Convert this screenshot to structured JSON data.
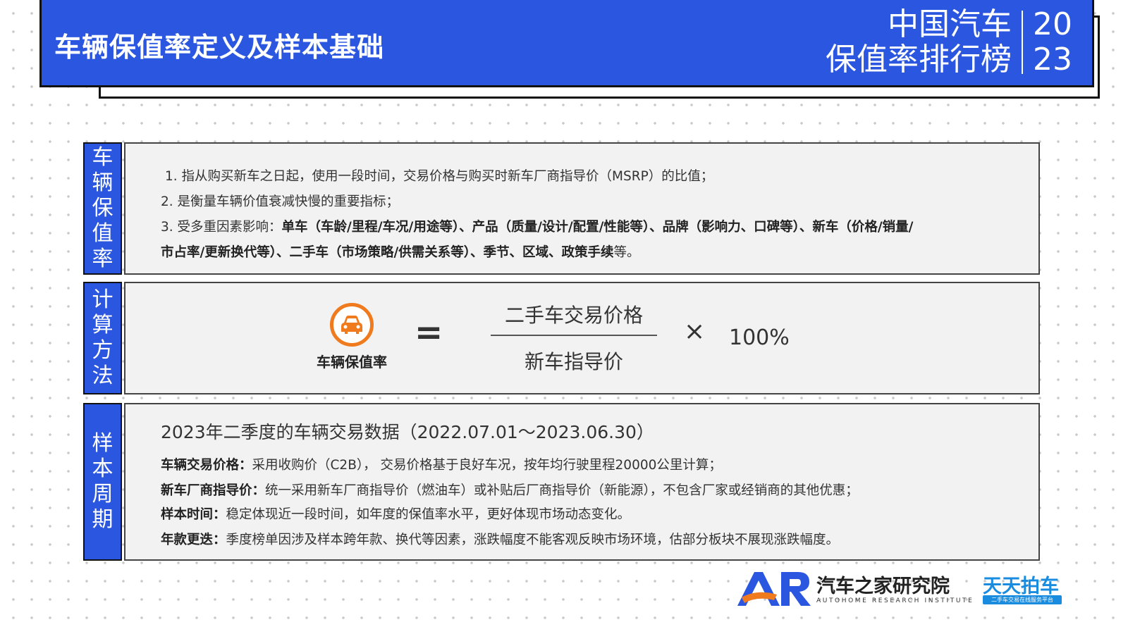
{
  "header": {
    "title": "车辆保值率定义及样本基础",
    "brand_line1": "中国汽车",
    "brand_line2": "保值率排行榜",
    "year_line1": "20",
    "year_line2": "23"
  },
  "definition": {
    "label": "车辆保值率",
    "line1": "1. 指从购买新车之日起，使用一段时间，交易价格与购买时新车厂商指导价（MSRP）的比值；",
    "line2": "2. 是衡量车辆价值衰减快慢的重要指标；",
    "line3_prefix": "3. 受多重因素影响：",
    "line3_bold": "单车（车龄/里程/车况/用途等）、产品（质量/设计/配置/性能等）、品牌（影响力、口碑等）、新车（价格/销量/",
    "line4_bold": "市占率/更新换代等）、二手车（市场策略/供需关系等）、季节、区域、政策手续",
    "line4_suffix": "等。"
  },
  "calculation": {
    "label": "计算方法",
    "lhs": "车辆保值率",
    "equals": "=",
    "numerator": "二手车交易价格",
    "denominator": "新车指导价",
    "times": "×",
    "percent": "100%"
  },
  "sample": {
    "label": "样本周期",
    "heading": "2023年二季度的车辆交易数据（2022.07.01～2023.06.30）",
    "items": [
      {
        "key": "车辆交易价格：",
        "value": "采用收购价（C2B）， 交易价格基于良好车况，按年均行驶里程20000公里计算；"
      },
      {
        "key": "新车厂商指导价：",
        "value": "统一采用新车厂商指导价（燃油车）或补贴后厂商指导价（新能源），不包含厂家或经销商的其他优惠；"
      },
      {
        "key": "样本时间：",
        "value": "稳定体现近一段时间，如年度的保值率水平，更好体现市场动态变化。"
      },
      {
        "key": "年款更迭：",
        "value": "季度榜单因涉及样本跨年款、换代等因素，涨跌幅度不能客观反映市场环境，估部分板块不展现涨跌幅度。"
      }
    ]
  },
  "footer": {
    "logo_mark": "AR",
    "org_name": "汽车之家研究院",
    "org_sub": "AUTOHOME RESEARCH INSTITUTE",
    "partner_name": "天天拍车",
    "partner_sub": "二手车交易在线服务平台"
  },
  "colors": {
    "primary_blue": "#2b56e0",
    "accent_orange": "#f07a1e",
    "partner_blue": "#1a8ce0"
  }
}
